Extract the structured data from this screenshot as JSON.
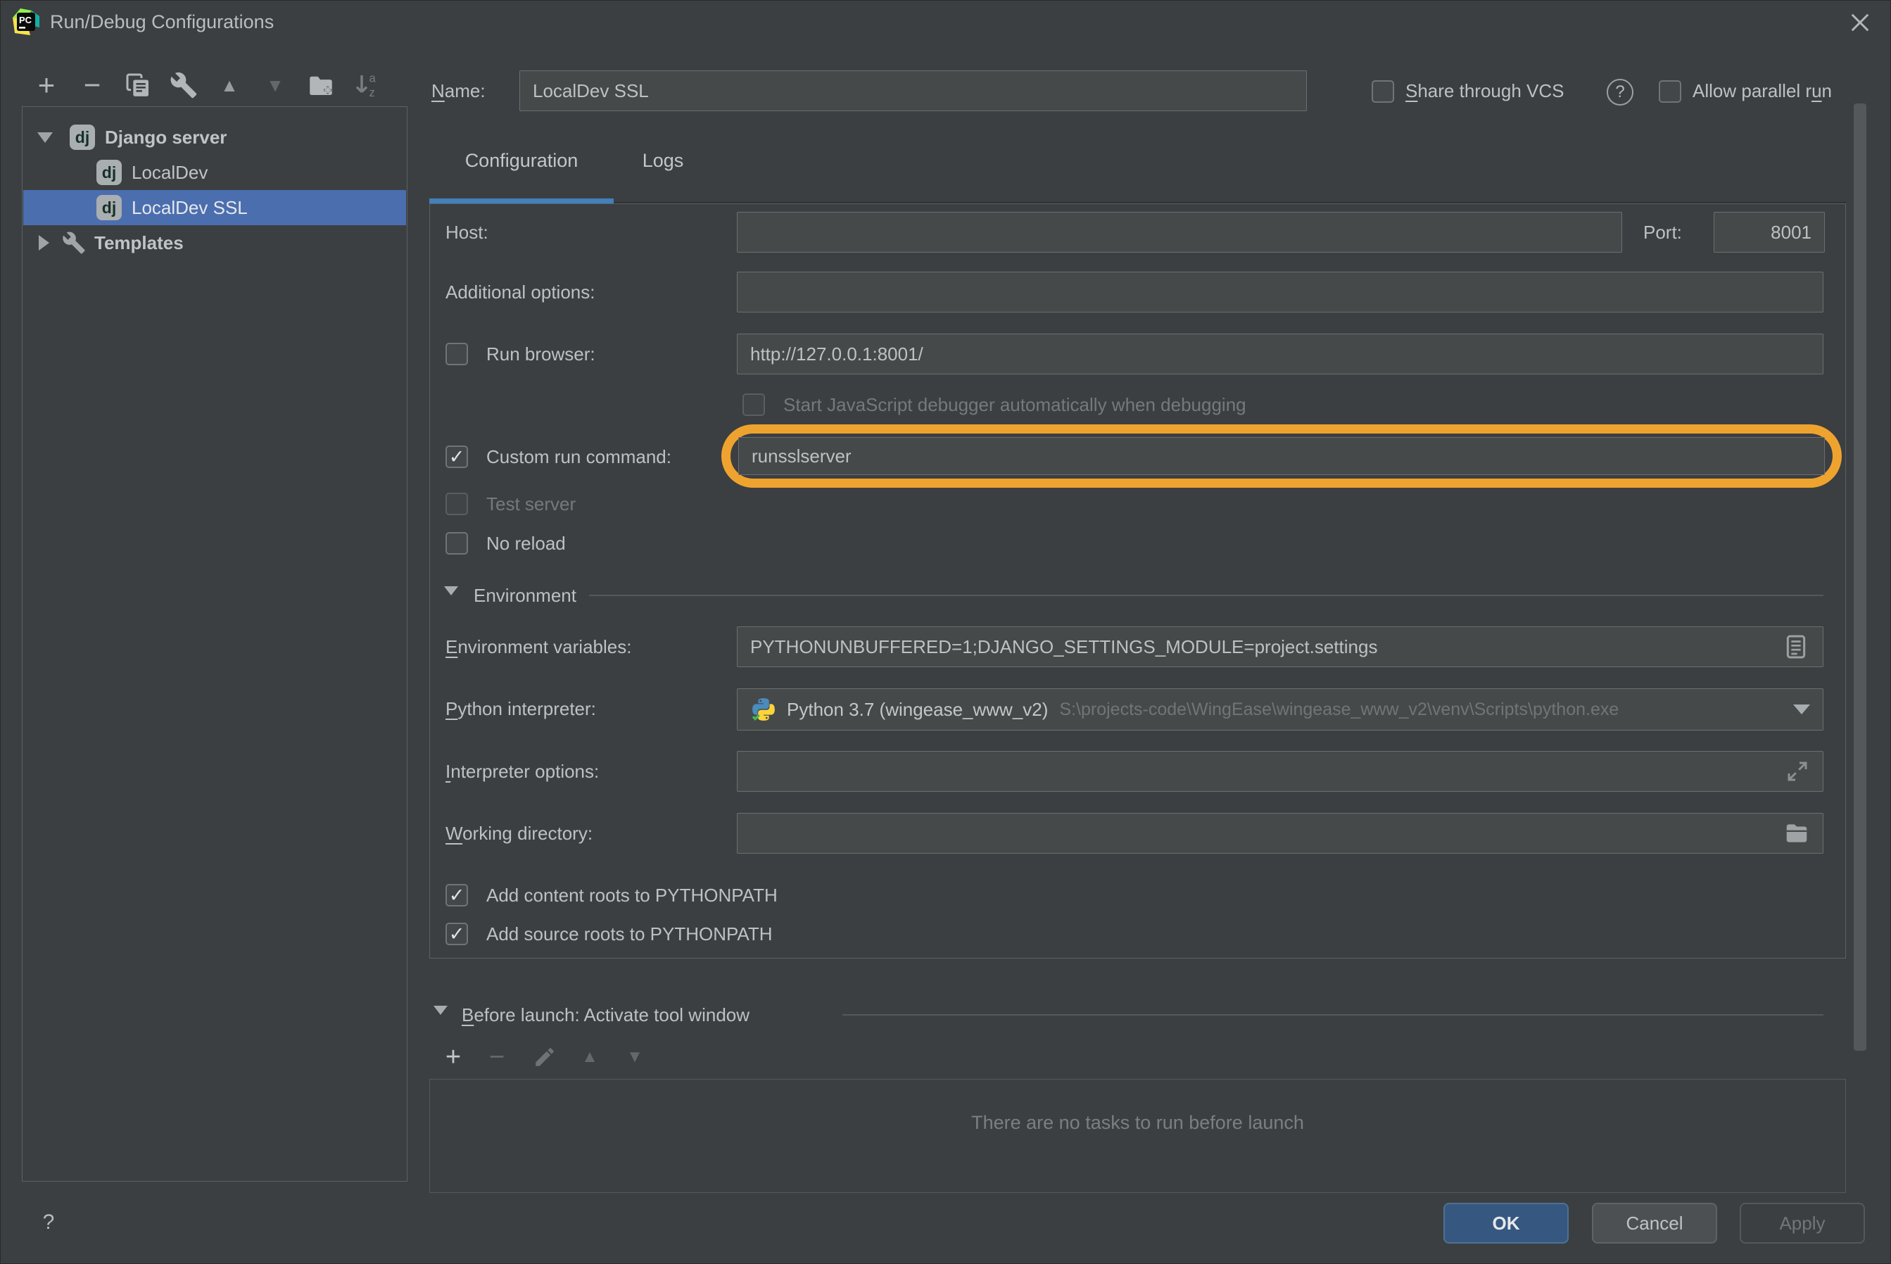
{
  "titlebar": {
    "title": "Run/Debug Configurations"
  },
  "icons": {
    "pycharm_logo": "PC",
    "dj_badge": "dj",
    "help_q": "?",
    "plus": "+",
    "minus": "−",
    "tri_up": "▲",
    "tri_down": "▼",
    "sort_a": "a",
    "sort_z": "z"
  },
  "tree": {
    "group": "Django server",
    "item1": "LocalDev",
    "item2": "LocalDev SSL",
    "templates": "Templates"
  },
  "header": {
    "name_label_u": "N",
    "name_label_rest": "ame:",
    "name_value": "LocalDev SSL",
    "share_u": "S",
    "share_rest": "hare through VCS",
    "parallel_pre": "Allow parallel r",
    "parallel_u": "u",
    "parallel_rest": "n"
  },
  "tabs": {
    "configuration": "Configuration",
    "logs": "Logs"
  },
  "form": {
    "host_label": "Host:",
    "host_value": "",
    "port_label": "Port:",
    "port_value": "8001",
    "additional_label": "Additional options:",
    "additional_value": "",
    "run_browser_label": "Run browser:",
    "run_browser_value": "http://127.0.0.1:8001/",
    "js_debugger_label": "Start JavaScript debugger automatically when debugging",
    "custom_run_label": "Custom run command:",
    "custom_run_value": "runsslserver",
    "test_server_label": "Test server",
    "no_reload_label": "No reload",
    "environment_section": "Environment",
    "env_vars_label_u": "E",
    "env_vars_label_rest": "nvironment variables:",
    "env_vars_value": "PYTHONUNBUFFERED=1;DJANGO_SETTINGS_MODULE=project.settings",
    "interpreter_label_u": "P",
    "interpreter_label_rest": "ython interpreter:",
    "interpreter_name": "Python 3.7 (wingease_www_v2)",
    "interpreter_path": "S:\\projects-code\\WingEase\\wingease_www_v2\\venv\\Scripts\\python.exe",
    "interpreter_options_label_u": "I",
    "interpreter_options_label_rest": "nterpreter options:",
    "interpreter_options_value": "",
    "working_directory_label_u": "W",
    "working_directory_label_rest": "orking directory:",
    "working_directory_value": "",
    "add_content_roots": "Add content roots to PYTHONPATH",
    "add_source_roots": "Add source roots to PYTHONPATH"
  },
  "before_launch": {
    "label_u": "B",
    "label_rest": "efore launch: Activate tool window",
    "empty": "There are no tasks to run before launch"
  },
  "footer": {
    "ok": "OK",
    "cancel": "Cancel",
    "apply": "Apply"
  },
  "colors": {
    "background": "#3c3f41",
    "field_background": "#45494a",
    "selection_blue": "#4b6eaf",
    "tab_accent_blue": "#4380bd",
    "ok_button_blue": "#365880",
    "annotation_orange": "#efa32f"
  }
}
